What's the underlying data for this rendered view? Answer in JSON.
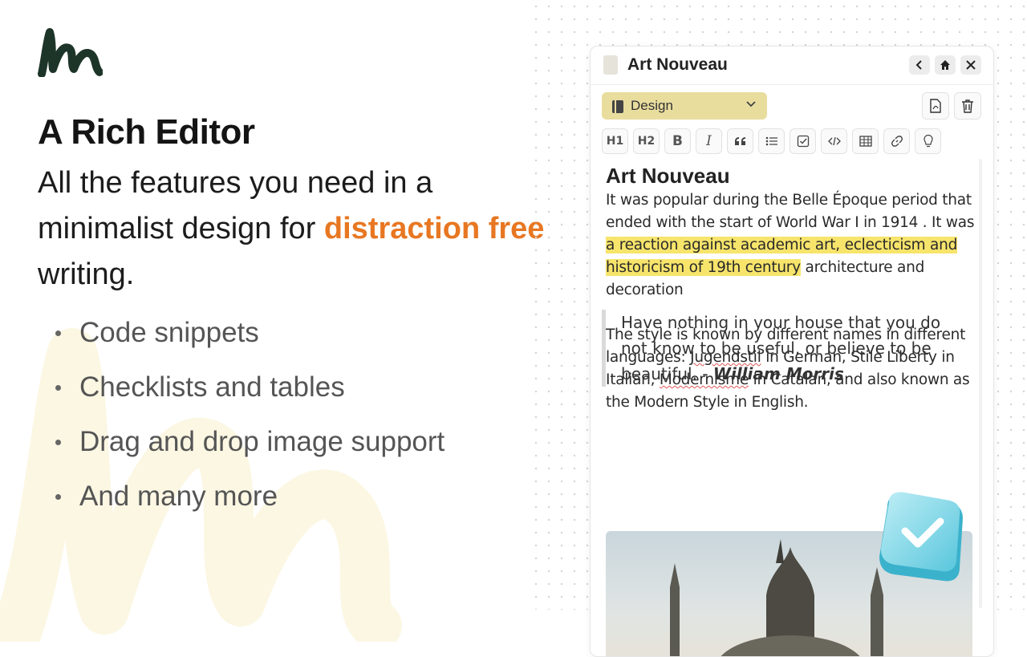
{
  "hero": {
    "title": "A Rich Editor",
    "subtitle_before": "All the features you need in a minimalist design for ",
    "subtitle_accent": "distraction free",
    "subtitle_after": " writing.",
    "accent_color": "#e87722"
  },
  "features": [
    "Code snippets",
    "Checklists and tables",
    "Drag and drop image support",
    "And many more"
  ],
  "editor": {
    "title": "Art Nouveau",
    "category": "Design",
    "category_color": "#e9dd9e",
    "header_icons": [
      "back-icon",
      "home-icon",
      "close-icon"
    ],
    "action_icons": [
      "pdf-export-icon",
      "trash-icon"
    ],
    "toolbar": {
      "h1": "H1",
      "h2": "H2",
      "bold": "B",
      "italic": "I",
      "icons": [
        "quote-icon",
        "bullet-list-icon",
        "checklist-icon",
        "code-icon",
        "table-icon",
        "link-icon",
        "lightbulb-icon"
      ]
    },
    "content": {
      "heading": "Art Nouveau",
      "p1_before": "It was popular during the Belle Époque period that ended with the start of World War I in 1914 . It was ",
      "p1_highlight": "a reaction against academic art, eclecticism and historicism of 19th century",
      "p1_after": " architecture and decoration",
      "p2_a": "The style is known by different names in different languages: ",
      "p2_word1": "Jugendstil",
      "p2_b": " in German, Stile Liberty in Italian, ",
      "p2_word2": "Modernisme",
      "p2_c": " in Catalan, and also known as the Modern Style in English.",
      "quote_text": "Have nothing in your house that you do not know to be useful, or believe to be beautiful. - ",
      "quote_author": "William Morris",
      "highlight_color": "#f7e46b"
    }
  }
}
